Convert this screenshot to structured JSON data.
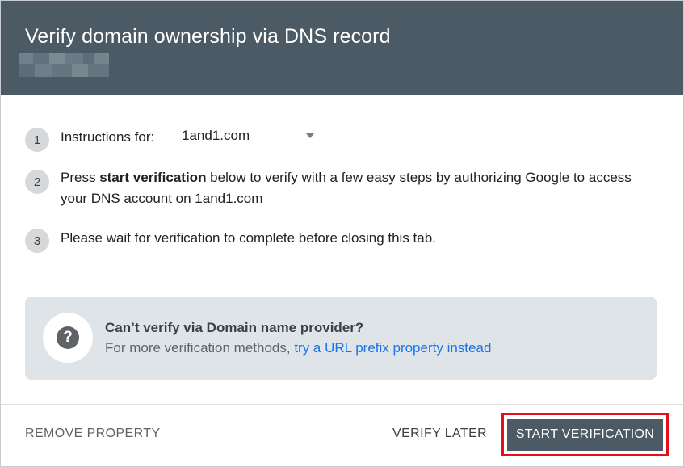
{
  "header": {
    "title": "Verify domain ownership via DNS record"
  },
  "steps": [
    {
      "number": "1",
      "label": "Instructions for:"
    },
    {
      "number": "2",
      "prefix": "Press ",
      "bold": "start verification",
      "suffix": " below to verify with a few easy steps by authorizing Google to access your DNS account on 1and1.com"
    },
    {
      "number": "3",
      "label": "Please wait for verification to complete before closing this tab."
    }
  ],
  "provider_select": {
    "value": "1and1.com"
  },
  "info": {
    "title": "Can’t verify via Domain name provider?",
    "desc_prefix": "For more verification methods, ",
    "link": "try a URL prefix property instead"
  },
  "footer": {
    "remove_label": "REMOVE PROPERTY",
    "later_label": "VERIFY LATER",
    "start_label": "START VERIFICATION"
  },
  "colors": {
    "header_bg": "#4b5a65",
    "link": "#1a73e8",
    "highlight": "#e3101c"
  },
  "icons": {
    "help": "question-circle",
    "dropdown": "caret-down"
  }
}
